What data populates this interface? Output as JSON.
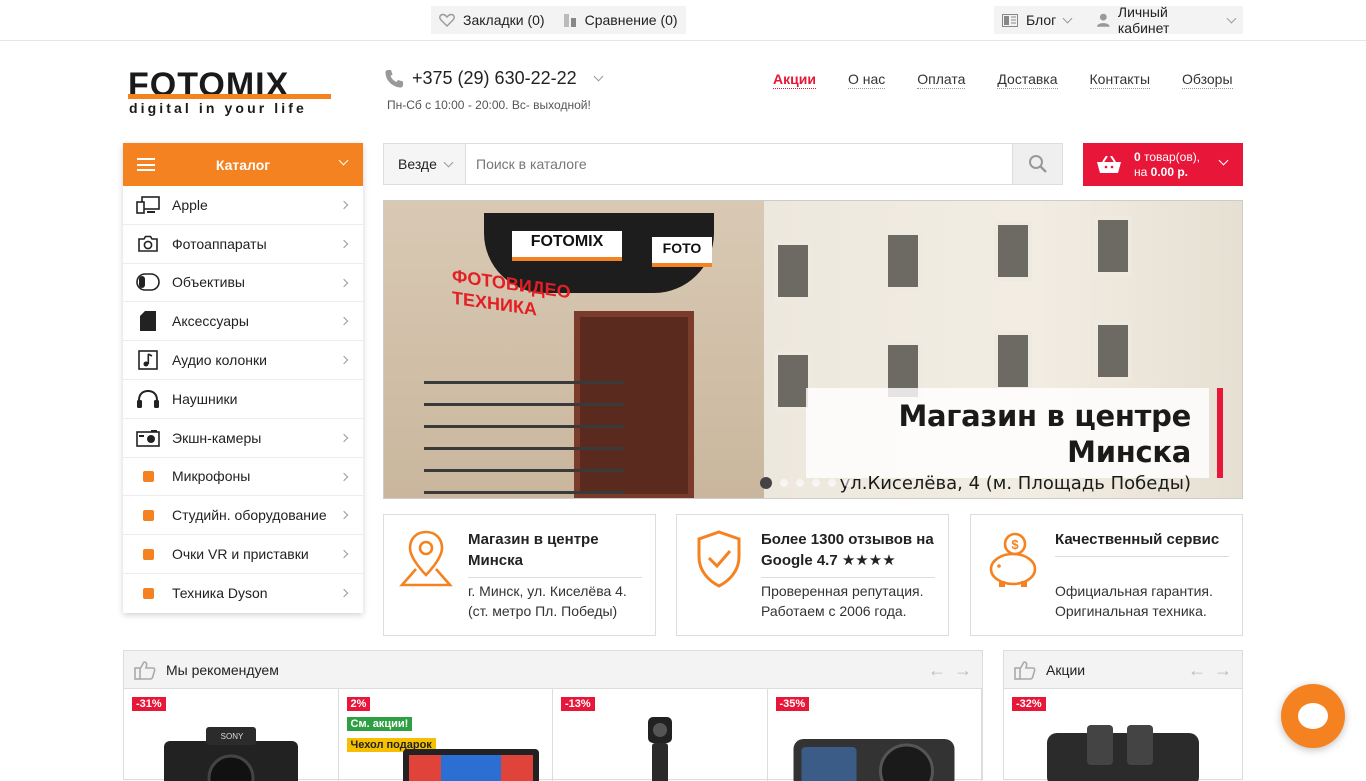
{
  "topbar": {
    "bookmarks": "Закладки (0)",
    "compare": "Сравнение (0)",
    "blog": "Блог",
    "account": "Личный кабинет"
  },
  "header": {
    "logo_main": "FOTOMIX",
    "logo_sub": "digital in your life",
    "phone": "+375 (29) 630-22-22",
    "hours": "Пн-Сб с 10:00 - 20:00. Вс- выходной!",
    "menu": [
      "Акции",
      "О нас",
      "Оплата",
      "Доставка",
      "Контакты",
      "Обзоры"
    ]
  },
  "catalog": {
    "title": "Каталог",
    "items": [
      {
        "label": "Apple",
        "icon": "devices-icon"
      },
      {
        "label": "Фотоаппараты",
        "icon": "camera-icon"
      },
      {
        "label": "Объективы",
        "icon": "lens-icon"
      },
      {
        "label": "Аксессуары",
        "icon": "sd-card-icon"
      },
      {
        "label": "Аудио колонки",
        "icon": "music-icon"
      },
      {
        "label": "Наушники",
        "icon": "headphones-icon"
      },
      {
        "label": "Экшн-камеры",
        "icon": "action-camera-icon"
      },
      {
        "label": "Микрофоны",
        "icon": "orange-square-icon"
      },
      {
        "label": "Студийн. оборудование",
        "icon": "orange-square-icon"
      },
      {
        "label": "Очки VR и приставки",
        "icon": "orange-square-icon"
      },
      {
        "label": "Техника Dyson",
        "icon": "orange-square-icon"
      }
    ]
  },
  "search": {
    "scope": "Везде",
    "placeholder": "Поиск в каталоге"
  },
  "cart": {
    "count": "0",
    "count_suffix": " товар(ов),",
    "prefix": "на ",
    "total": "0.00 р."
  },
  "banner": {
    "title": "Магазин в центре Минска",
    "subtitle": "ул.Киселёва, 4 (м. Площадь Победы)",
    "sign_text": "ФОТОВИДЕО ТЕХНИКА",
    "slides": 6,
    "active_slide": 1
  },
  "features": [
    {
      "title": "Магазин в центре Минска",
      "text": "г. Минск, ул. Киселёва 4. (ст. метро Пл. Победы)",
      "icon": "map-pin-icon"
    },
    {
      "title": "Более 1300 отзывов на Google 4.7 ★★★★",
      "text": "Проверенная репутация. Работаем с 2006 года.",
      "icon": "shield-check-icon"
    },
    {
      "title": "Качественный сервис",
      "text": "Официальная гарантия. Оригинальная техника.",
      "icon": "piggy-bank-icon"
    }
  ],
  "recommend": {
    "title": "Мы рекомендуем",
    "cards": [
      {
        "badge": "-31%"
      },
      {
        "badge": "2%",
        "badge2": "См. акции!",
        "badge3": "Чехол подарок"
      },
      {
        "badge": "-13%"
      },
      {
        "badge": "-35%"
      }
    ]
  },
  "promo": {
    "title": "Акции",
    "cards": [
      {
        "badge": "-32%"
      }
    ]
  },
  "colors": {
    "accent": "#f58220",
    "hot": "#e8173a"
  }
}
